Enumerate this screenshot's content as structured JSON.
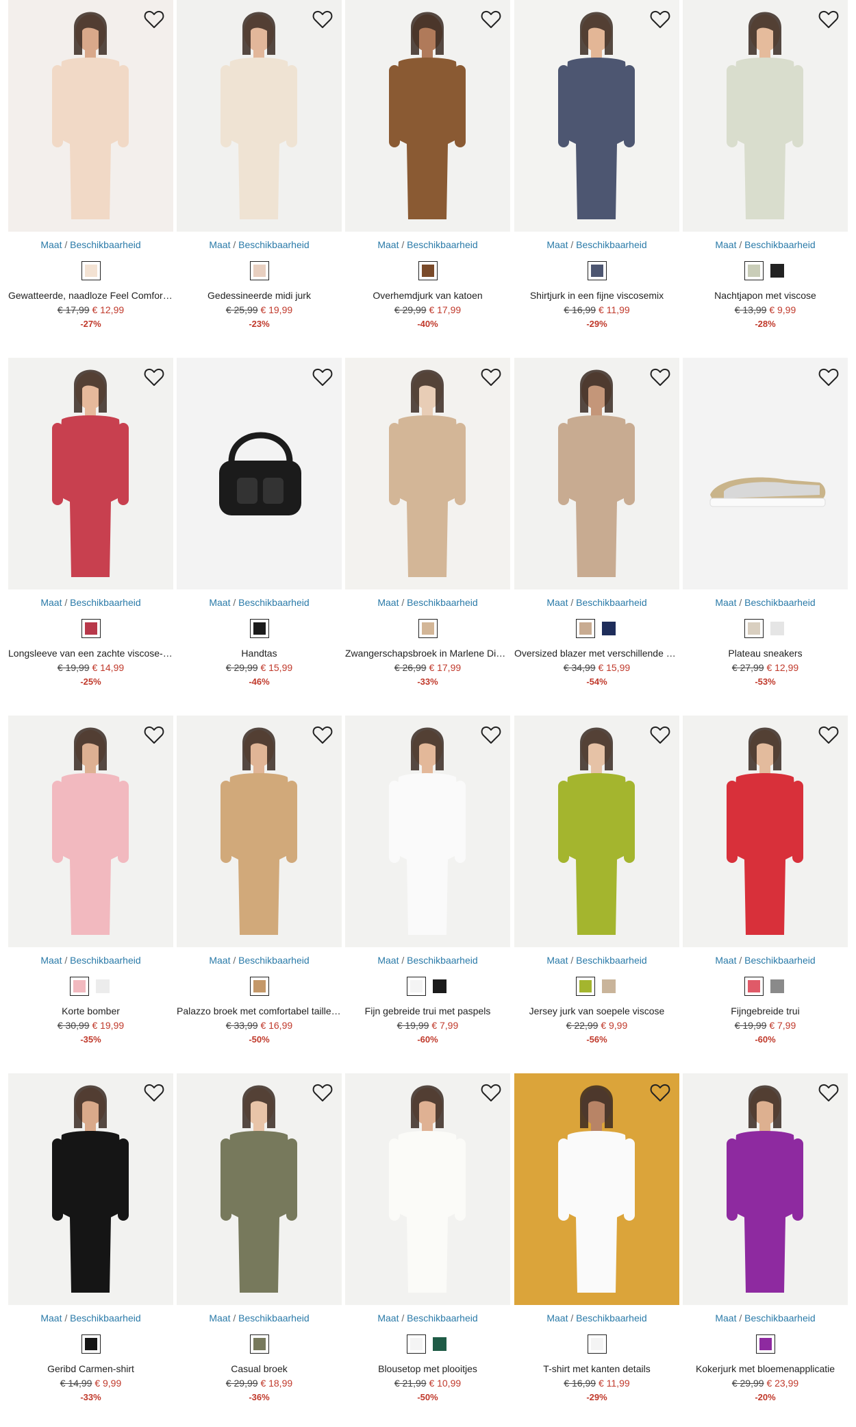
{
  "avail_label_left": "Maat",
  "avail_label_sep": "/",
  "avail_label_right": "Beschikbaarheid",
  "icon_wishlist": "heart-icon",
  "colors": {
    "link": "#2a7aa8",
    "sale": "#c0392b",
    "text": "#222222"
  },
  "products": [
    {
      "name": "Gewatteerde, naadloze Feel Comfort bh",
      "old": "€ 17,99",
      "new": "€ 12,99",
      "disc": "-27%",
      "bg": "#f3efec",
      "garment": "#f1d9c6",
      "skin": "#d9a88a",
      "swatches": [
        "#f3e2d3"
      ]
    },
    {
      "name": "Gedessineerde midi jurk",
      "old": "€ 25,99",
      "new": "€ 19,99",
      "disc": "-23%",
      "bg": "#f1f1ef",
      "garment": "#efe3d3",
      "skin": "#e2b79a",
      "swatches": [
        "#e8cfc0"
      ]
    },
    {
      "name": "Overhemdjurk van katoen",
      "old": "€ 29,99",
      "new": "€ 17,99",
      "disc": "-40%",
      "bg": "#f2f2f0",
      "garment": "#8a5a33",
      "skin": "#b07a5a",
      "swatches": [
        "#7a4a2a"
      ]
    },
    {
      "name": "Shirtjurk in een fijne viscosemix",
      "old": "€ 16,99",
      "new": "€ 11,99",
      "disc": "-29%",
      "bg": "#f3f3f1",
      "garment": "#4d5671",
      "skin": "#e3b696",
      "swatches": [
        "#4d5671"
      ]
    },
    {
      "name": "Nachtjapon met viscose",
      "old": "€ 13,99",
      "new": "€ 9,99",
      "disc": "-28%",
      "bg": "#f2f2f0",
      "garment": "#d9ddcd",
      "skin": "#e5bb9c",
      "swatches": [
        "#c9cdb8",
        "#222222"
      ]
    },
    {
      "name": "Longsleeve van een zachte viscose-shirt",
      "old": "€ 19,99",
      "new": "€ 14,99",
      "disc": "-25%",
      "bg": "#f2f2f0",
      "garment": "#c8404f",
      "skin": "#e6b99b",
      "swatches": [
        "#b8384a"
      ]
    },
    {
      "name": "Handtas",
      "old": "€ 29,99",
      "new": "€ 15,99",
      "disc": "-46%",
      "bg": "#f3f3f3",
      "garment": "#1b1b1b",
      "skin": "",
      "swatches": [
        "#1b1b1b"
      ]
    },
    {
      "name": "Zwangerschapsbroek in Marlene Dietrich-stijl",
      "old": "€ 26,99",
      "new": "€ 17,99",
      "disc": "-33%",
      "bg": "#f3f2ef",
      "garment": "#d3b697",
      "skin": "#e8cdb6",
      "swatches": [
        "#d3b697"
      ]
    },
    {
      "name": "Oversized blazer met verschillende draagwijzen",
      "old": "€ 34,99",
      "new": "€ 15,99",
      "disc": "-54%",
      "bg": "#f2f2f0",
      "garment": "#c8ab91",
      "skin": "#c49679",
      "swatches": [
        "#c8ab91",
        "#1e2d5a"
      ]
    },
    {
      "name": "Plateau sneakers",
      "old": "€ 27,99",
      "new": "€ 12,99",
      "disc": "-53%",
      "bg": "#f3f3f3",
      "garment": "#c9b48a",
      "skin": "",
      "swatches": [
        "#d9cfc0",
        "#e5e5e5"
      ]
    },
    {
      "name": "Korte bomber",
      "old": "€ 30,99",
      "new": "€ 19,99",
      "disc": "-35%",
      "bg": "#f2f2f0",
      "garment": "#f2b9bf",
      "skin": "#ddb092",
      "swatches": [
        "#f2b9bf",
        "#ececec"
      ]
    },
    {
      "name": "Palazzo broek met comfortabel tailleband",
      "old": "€ 33,99",
      "new": "€ 16,99",
      "disc": "-50%",
      "bg": "#f2f2f0",
      "garment": "#d1a97a",
      "skin": "#e0b596",
      "swatches": [
        "#c49869"
      ]
    },
    {
      "name": "Fijn gebreide trui met paspels",
      "old": "€ 19,99",
      "new": "€ 7,99",
      "disc": "-60%",
      "bg": "#f2f2f0",
      "garment": "#fafafa",
      "skin": "#e3b899",
      "swatches": [
        "#f4f4f4",
        "#1b1b1b"
      ]
    },
    {
      "name": "Jersey jurk van soepele viscose",
      "old": "€ 22,99",
      "new": "€ 9,99",
      "disc": "-56%",
      "bg": "#f2f2f0",
      "garment": "#a4b52e",
      "skin": "#e6c2a6",
      "swatches": [
        "#a4b52e",
        "#c9b49a"
      ]
    },
    {
      "name": "Fijngebreide trui",
      "old": "€ 19,99",
      "new": "€ 7,99",
      "disc": "-60%",
      "bg": "#f2f2f0",
      "garment": "#d8303a",
      "skin": "#e3bb9d",
      "swatches": [
        "#e05a68",
        "#8a8a8a"
      ]
    },
    {
      "name": "Geribd Carmen-shirt",
      "old": "€ 14,99",
      "new": "€ 9,99",
      "disc": "-33%",
      "bg": "#f2f2f0",
      "garment": "#151515",
      "skin": "#d9a98a",
      "swatches": [
        "#151515"
      ]
    },
    {
      "name": "Casual broek",
      "old": "€ 29,99",
      "new": "€ 18,99",
      "disc": "-36%",
      "bg": "#f2f2f0",
      "garment": "#77795c",
      "skin": "#e8c4a8",
      "swatches": [
        "#77795c"
      ]
    },
    {
      "name": "Blousetop met plooitjes",
      "old": "€ 21,99",
      "new": "€ 10,99",
      "disc": "-50%",
      "bg": "#f2f2f0",
      "garment": "#fbfbf8",
      "skin": "#dfb193",
      "swatches": [
        "#f4f4f4",
        "#1f5b46"
      ]
    },
    {
      "name": "T-shirt met kanten details",
      "old": "€ 16,99",
      "new": "€ 11,99",
      "disc": "-29%",
      "bg": "#dba43a",
      "garment": "#fafafa",
      "skin": "#b88466",
      "swatches": [
        "#f4f4f4"
      ]
    },
    {
      "name": "Kokerjurk met bloemenapplicatie",
      "old": "€ 29,99",
      "new": "€ 23,99",
      "disc": "-20%",
      "bg": "#f2f2f0",
      "garment": "#8e2aa0",
      "skin": "#ddb090",
      "swatches": [
        "#8e2aa0"
      ]
    }
  ]
}
